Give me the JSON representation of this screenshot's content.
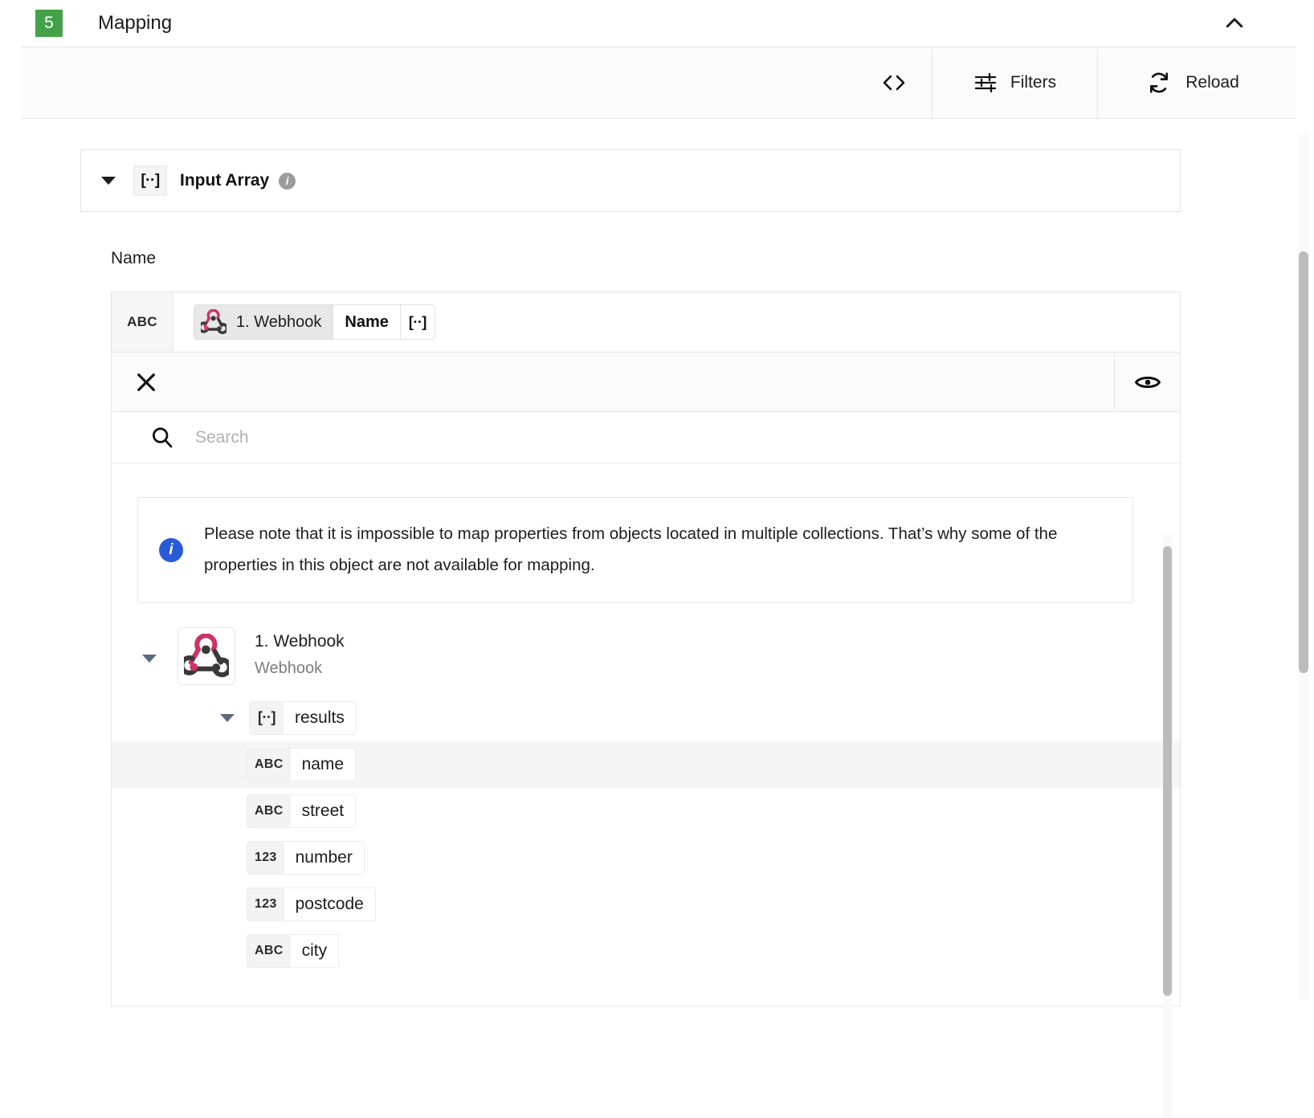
{
  "header": {
    "step_number": "5",
    "title": "Mapping",
    "badge_color": "#45a04a",
    "collapse_icon": "chevron-up-icon"
  },
  "toolbar": {
    "code_icon": "code-brackets-icon",
    "filters_icon": "sliders-icon",
    "filters_label": "Filters",
    "reload_icon": "refresh-icon",
    "reload_label": "Reload"
  },
  "input_array": {
    "expand_icon": "caret-down-icon",
    "type_badge": "[··]",
    "label": "Input Array",
    "info_icon": "info-circle-icon",
    "info_char": "i"
  },
  "field": {
    "label": "Name",
    "type_badge": "ABC",
    "token": {
      "source_icon": "webhook-icon",
      "source_label": "1. Webhook",
      "property_label": "Name",
      "array_badge": "[··]"
    },
    "clear_icon": "close-icon",
    "preview_icon": "eye-icon"
  },
  "dropdown": {
    "search": {
      "icon": "search-icon",
      "value": "",
      "placeholder": "Search"
    },
    "notice": {
      "icon": "info-circle-icon",
      "icon_char": "i",
      "icon_color": "#2a5bd7",
      "text": "Please note that it is impossible to map properties from objects located in multiple collections. That’s why some of the properties in this object are not available for mapping."
    },
    "tree": {
      "root": {
        "expand_icon": "caret-down-icon",
        "app_icon": "webhook-icon",
        "title": "1. Webhook",
        "subtitle": "Webhook"
      },
      "group": {
        "expand_icon": "caret-down-icon",
        "type_badge": "[··]",
        "label": "results"
      },
      "items": [
        {
          "type_badge": "ABC",
          "label": "name",
          "selected": true
        },
        {
          "type_badge": "ABC",
          "label": "street",
          "selected": false
        },
        {
          "type_badge": "123",
          "label": "number",
          "selected": false
        },
        {
          "type_badge": "123",
          "label": "postcode",
          "selected": false
        },
        {
          "type_badge": "ABC",
          "label": "city",
          "selected": false
        }
      ]
    }
  },
  "scrollbars": {
    "page_scrollbar": "vertical-scrollbar",
    "dropdown_scrollbar": "vertical-scrollbar"
  }
}
